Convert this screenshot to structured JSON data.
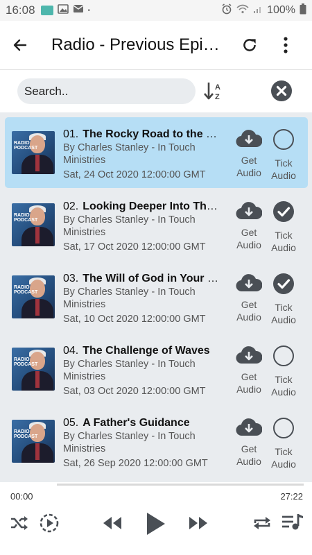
{
  "status_bar": {
    "time": "16:08",
    "battery": "100%"
  },
  "app_bar": {
    "title": "Radio - Previous Episodes"
  },
  "search": {
    "placeholder": "Search.."
  },
  "episodes": [
    {
      "number": "01.",
      "title": "The Rocky Road to the Promised Land",
      "author": "By Charles Stanley - In Touch Ministries",
      "date": "Sat, 24 Oct 2020 12:00:00 GMT",
      "get_label": "Get Audio",
      "tick_label": "Tick Audio",
      "ticked": false,
      "selected": true
    },
    {
      "number": "02.",
      "title": "Looking Deeper Into The Promises",
      "author": "By Charles Stanley - In Touch Ministries",
      "date": "Sat, 17 Oct 2020 12:00:00 GMT",
      "get_label": "Get Audio",
      "tick_label": "Tick Audio",
      "ticked": true,
      "selected": false
    },
    {
      "number": "03.",
      "title": "The Will of God in Your Life",
      "author": "By Charles Stanley - In Touch Ministries",
      "date": "Sat, 10 Oct 2020 12:00:00 GMT",
      "get_label": "Get Audio",
      "tick_label": "Tick Audio",
      "ticked": true,
      "selected": false
    },
    {
      "number": "04.",
      "title": "The Challenge of Waves",
      "author": "By Charles Stanley - In Touch Ministries",
      "date": "Sat, 03 Oct 2020 12:00:00 GMT",
      "get_label": "Get Audio",
      "tick_label": "Tick Audio",
      "ticked": false,
      "selected": false
    },
    {
      "number": "05.",
      "title": "A Father's Guidance",
      "author": "By Charles Stanley - In Touch Ministries",
      "date": "Sat, 26 Sep 2020 12:00:00 GMT",
      "get_label": "Get Audio",
      "tick_label": "Tick Audio",
      "ticked": false,
      "selected": false
    }
  ],
  "thumbnail": {
    "label": "RADIO PODCAST"
  },
  "player": {
    "current_time": "00:00",
    "total_time": "27:22",
    "progress": 0
  },
  "icons": {
    "back": "arrow-left-icon",
    "refresh": "refresh-icon",
    "more": "more-vert-icon",
    "sort": "sort-az-icon",
    "clear": "clear-circle-icon",
    "download": "cloud-download-icon",
    "tick": "check-circle-icon",
    "shuffle": "shuffle-icon",
    "speed": "playback-speed-icon",
    "rewind": "rewind-icon",
    "play": "play-icon",
    "forward": "fast-forward-icon",
    "repeat": "repeat-icon",
    "playlist": "playlist-music-icon"
  },
  "colors": {
    "selected_row": "#b6def5",
    "icon": "#4a4f55",
    "background": "#e9ecef"
  }
}
